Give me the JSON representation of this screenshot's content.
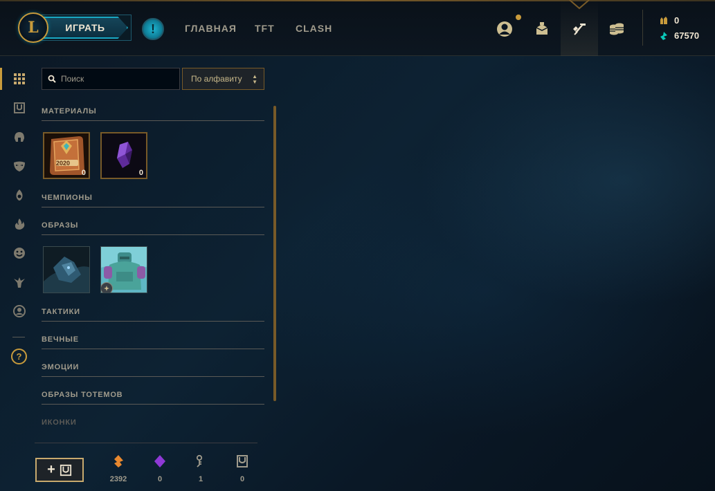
{
  "header": {
    "logo_letter": "L",
    "play_label": "ИГРАТЬ",
    "alert_symbol": "!",
    "nav": [
      "ГЛАВНАЯ",
      "TFT",
      "CLASH"
    ],
    "icons": [
      "profile-icon",
      "collection-icon",
      "crafting-icon",
      "store-icon"
    ],
    "currency": {
      "rp_value": "0",
      "be_value": "67570"
    }
  },
  "rail": {
    "items": [
      "grid-icon",
      "chest-icon",
      "helmet-icon",
      "mask-icon",
      "ward-icon",
      "fire-icon",
      "emote-icon",
      "totem-icon",
      "profile-circle-icon"
    ],
    "help_symbol": "?"
  },
  "toolbar": {
    "search_placeholder": "Поиск",
    "sort_label": "По алфавиту"
  },
  "inventory": {
    "sections": [
      {
        "title": "МАТЕРИАЛЫ"
      },
      {
        "title": "ЧЕМПИОНЫ"
      },
      {
        "title": "ОБРАЗЫ"
      },
      {
        "title": "ТАКТИКИ"
      },
      {
        "title": "ВЕЧНЫЕ"
      },
      {
        "title": "ЭМОЦИИ"
      },
      {
        "title": "ОБРАЗЫ ТОТЕМОВ"
      },
      {
        "title": "ИКОНКИ"
      }
    ],
    "materials": [
      {
        "name": "event-pass-icon",
        "label": "2020",
        "count": "0"
      },
      {
        "name": "gemstone-icon",
        "count": "0"
      }
    ],
    "skins": [
      {
        "name": "skin-thumbnail-dark"
      },
      {
        "name": "skin-thumbnail-armored"
      }
    ]
  },
  "footer": {
    "add_label": "+",
    "counters": [
      {
        "name": "orange-essence-icon",
        "value": "2392"
      },
      {
        "name": "mythic-essence-icon",
        "value": "0"
      },
      {
        "name": "key-icon",
        "value": "1"
      },
      {
        "name": "chest-icon",
        "value": "0"
      }
    ]
  },
  "colors": {
    "gold": "#c89b3c",
    "teal": "#0ac8b9",
    "text": "#a09b8c"
  }
}
